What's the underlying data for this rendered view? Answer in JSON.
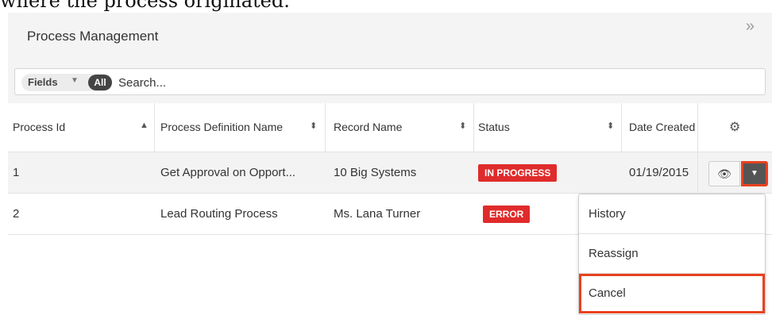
{
  "caption": "where the process originated.",
  "panel": {
    "title": "Process Management",
    "collapse_icon": "double-chevron-right-icon"
  },
  "filter": {
    "fields_label": "Fields",
    "all_label": "All",
    "search_placeholder": "Search..."
  },
  "table": {
    "headers": [
      {
        "label": "Process Id",
        "sort": "▲"
      },
      {
        "label": "Process Definition Name",
        "sort": "⬍"
      },
      {
        "label": "Record Name",
        "sort": "⬍"
      },
      {
        "label": "Status",
        "sort": "⬍"
      },
      {
        "label": "Date Created",
        "sort": ""
      }
    ],
    "settings_icon": "gear-icon",
    "rows": [
      {
        "id": "1",
        "definition": "Get Approval on Opport...",
        "record": "10 Big Systems",
        "status": "IN PROGRESS",
        "date": "01/19/2015"
      },
      {
        "id": "2",
        "definition": "Lead Routing Process",
        "record": "Ms. Lana Turner",
        "status": "ERROR",
        "date": ""
      }
    ]
  },
  "actions": {
    "preview_icon": "eye-icon",
    "dropdown_icon": "caret-down-icon"
  },
  "menu": {
    "items": [
      "History",
      "Reassign",
      "Cancel"
    ]
  },
  "colors": {
    "status_red": "#e02b2b",
    "highlight_orange": "#e8421f"
  }
}
